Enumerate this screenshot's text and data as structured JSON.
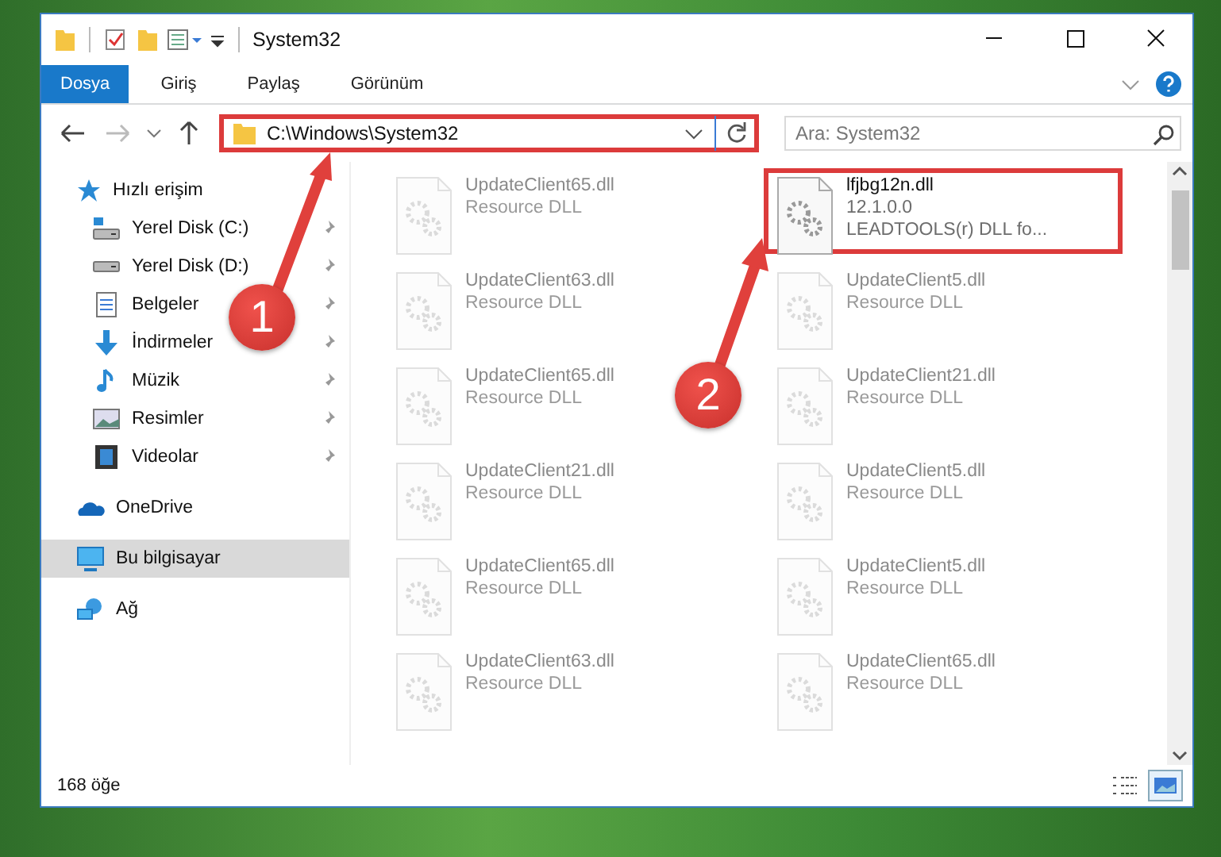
{
  "window": {
    "title": "System32"
  },
  "ribbon_tabs": [
    {
      "label": "Dosya",
      "selected": true
    },
    {
      "label": "Giriş",
      "selected": false
    },
    {
      "label": "Paylaş",
      "selected": false
    },
    {
      "label": "Görünüm",
      "selected": false
    }
  ],
  "address": {
    "path": "C:\\Windows\\System32",
    "highlighted": true
  },
  "search": {
    "placeholder": "Ara: System32"
  },
  "sidebar": {
    "items": [
      {
        "label": "Hızlı erişim",
        "kind": "star",
        "selected": false,
        "children": [
          {
            "label": "Yerel Disk (C:)",
            "kind": "drive-c",
            "pinned": true
          },
          {
            "label": "Yerel Disk (D:)",
            "kind": "drive",
            "pinned": true
          },
          {
            "label": "Belgeler",
            "kind": "document",
            "pinned": true
          },
          {
            "label": "İndirmeler",
            "kind": "download",
            "pinned": true
          },
          {
            "label": "Müzik",
            "kind": "music",
            "pinned": true
          },
          {
            "label": "Resimler",
            "kind": "picture",
            "pinned": true
          },
          {
            "label": "Videolar",
            "kind": "video",
            "pinned": true
          }
        ]
      },
      {
        "label": "OneDrive",
        "kind": "cloud",
        "selected": false
      },
      {
        "label": "Bu bilgisayar",
        "kind": "computer",
        "selected": true
      },
      {
        "label": "Ağ",
        "kind": "network",
        "selected": false
      }
    ]
  },
  "files": [
    {
      "name": "UpdateClient65.dll",
      "lines": [
        "Resource DLL"
      ],
      "highlighted": false,
      "dimmed": true
    },
    {
      "name": "lfjbg12n.dll",
      "lines": [
        "12.1.0.0",
        "LEADTOOLS(r) DLL fo..."
      ],
      "highlighted": true,
      "dimmed": false
    },
    {
      "name": "UpdateClient63.dll",
      "lines": [
        "Resource DLL"
      ],
      "highlighted": false,
      "dimmed": true
    },
    {
      "name": "UpdateClient5.dll",
      "lines": [
        "Resource DLL"
      ],
      "highlighted": false,
      "dimmed": true
    },
    {
      "name": "UpdateClient65.dll",
      "lines": [
        "Resource DLL"
      ],
      "highlighted": false,
      "dimmed": true
    },
    {
      "name": "UpdateClient21.dll",
      "lines": [
        "Resource DLL"
      ],
      "highlighted": false,
      "dimmed": true
    },
    {
      "name": "UpdateClient21.dll",
      "lines": [
        "Resource DLL"
      ],
      "highlighted": false,
      "dimmed": true
    },
    {
      "name": "UpdateClient5.dll",
      "lines": [
        "Resource DLL"
      ],
      "highlighted": false,
      "dimmed": true
    },
    {
      "name": "UpdateClient65.dll",
      "lines": [
        "Resource DLL"
      ],
      "highlighted": false,
      "dimmed": true
    },
    {
      "name": "UpdateClient5.dll",
      "lines": [
        "Resource DLL"
      ],
      "highlighted": false,
      "dimmed": true
    },
    {
      "name": "UpdateClient63.dll",
      "lines": [
        "Resource DLL"
      ],
      "highlighted": false,
      "dimmed": true
    },
    {
      "name": "UpdateClient65.dll",
      "lines": [
        "Resource DLL"
      ],
      "highlighted": false,
      "dimmed": true
    }
  ],
  "status_bar": {
    "count": "168 öğe"
  },
  "view_buttons": [
    {
      "kind": "details",
      "selected": false
    },
    {
      "kind": "large-icons",
      "selected": true
    }
  ],
  "annotations": [
    {
      "label": "1"
    },
    {
      "label": "2"
    }
  ]
}
